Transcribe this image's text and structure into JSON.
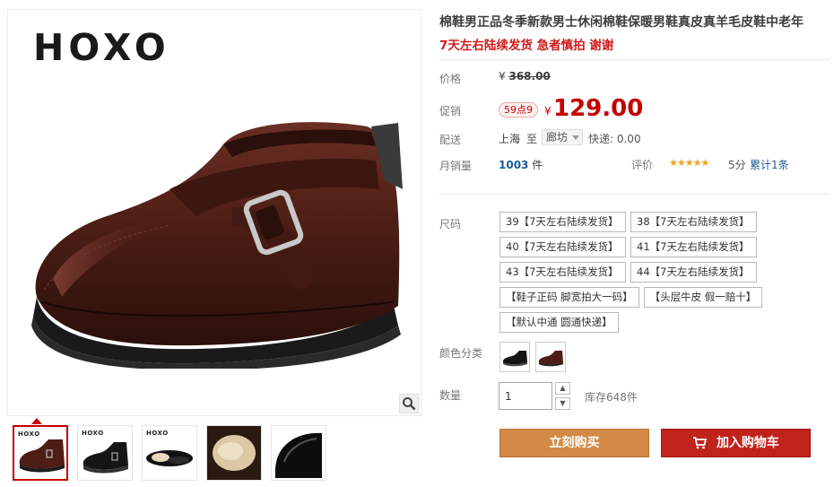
{
  "gallery": {
    "brand": "HOXO",
    "thumb_brand": "HOXO",
    "zoom_icon": "search-icon",
    "thumbnail_count": 5,
    "active_thumbnail": 1
  },
  "product": {
    "title": "棉鞋男正品冬季新款男士休闲棉鞋保暖男鞋真皮真羊毛皮鞋中老年",
    "subtitle": "7天左右陆续发货 急者慎拍 谢谢"
  },
  "price": {
    "label": "价格",
    "currency": "¥",
    "original": "368.00"
  },
  "promo": {
    "label": "促销",
    "badge": "59点9",
    "currency": "¥",
    "price": "129.00"
  },
  "shipping": {
    "label": "配送",
    "from": "上海",
    "to_word": "至",
    "destination": "廊坊",
    "fee": "快递: 0.00"
  },
  "sales": {
    "label": "月销量",
    "count": "1003",
    "unit": "件",
    "rating_label": "评价",
    "stars": "★★★★★",
    "score": "5分",
    "reviews": "累计1条"
  },
  "sku": {
    "label": "尺码",
    "options": [
      "39【7天左右陆续发货】",
      "38【7天左右陆续发货】",
      "40【7天左右陆续发货】",
      "41【7天左右陆续发货】",
      "43【7天左右陆续发货】",
      "44【7天左右陆续发货】",
      "【鞋子正码 脚宽拍大一码】",
      "【头层牛皮 假一赔十】",
      "【默认中通 圆通快递】"
    ]
  },
  "color": {
    "label": "颜色分类"
  },
  "quantity": {
    "label": "数量",
    "value": "1",
    "up": "▲",
    "down": "▼",
    "stock": "库存648件"
  },
  "actions": {
    "buy_now": "立刻购买",
    "add_cart": "加入购物车",
    "cart_icon": "cart-icon"
  },
  "colors": {
    "accent_red": "#c40000",
    "buy_orange": "#d28a46",
    "cart_red": "#c0231c",
    "link_blue": "#1c5a96"
  }
}
